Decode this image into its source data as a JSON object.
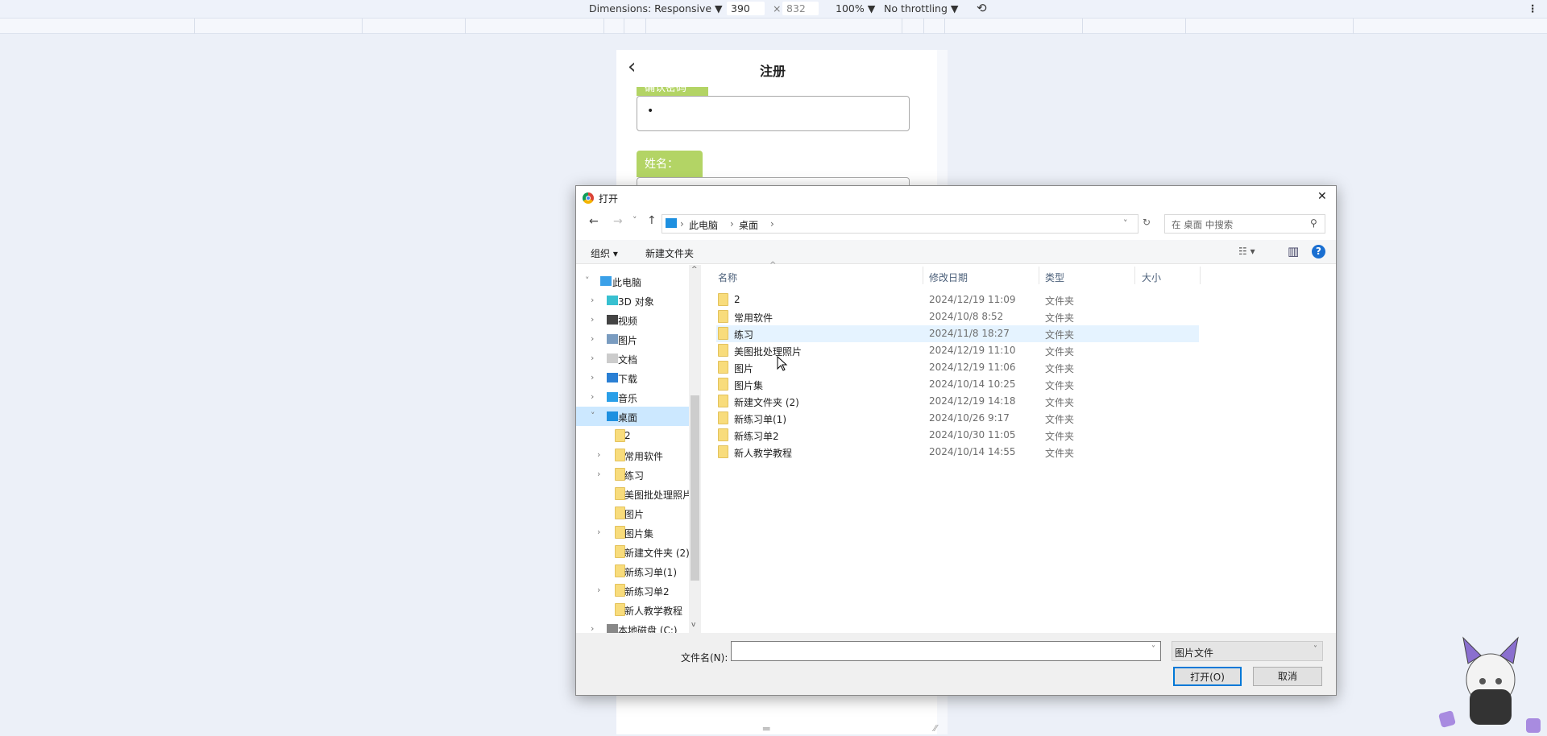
{
  "devtools": {
    "dimensions_label": "Dimensions: Responsive ▼",
    "width": "390",
    "times": "×",
    "height": "832",
    "zoom": "100% ▼",
    "throttling": "No throttling ▼",
    "rotate_icon": "rotate-icon",
    "more_icon": "⋮"
  },
  "mobile": {
    "back": "‹",
    "title": "注册",
    "field1_label": "确认密码",
    "field1_value": "•",
    "field2_label": "姓名：",
    "handle": "═",
    "resize": "⁄⁄"
  },
  "dialog": {
    "title": "打开",
    "close": "✕",
    "nav": {
      "back": "←",
      "forward": "→",
      "recent": "˅",
      "up": "↑",
      "breadcrumb": [
        "此电脑",
        "桌面"
      ],
      "sep": "›",
      "dropdown": "˅",
      "refresh": "↻",
      "search_placeholder": "在 桌面 中搜索",
      "search_icon": "⚲"
    },
    "toolbar": {
      "organize": "组织 ▾",
      "new_folder": "新建文件夹",
      "view": "☷ ▾",
      "pane": "▥",
      "help": "?"
    },
    "tree": [
      {
        "label": "此电脑",
        "chev": "˅",
        "icon": "pc"
      },
      {
        "label": "3D 对象",
        "chev": "›",
        "icon": "3d"
      },
      {
        "label": "视频",
        "chev": "›",
        "icon": "video"
      },
      {
        "label": "图片",
        "chev": "›",
        "icon": "picture"
      },
      {
        "label": "文档",
        "chev": "›",
        "icon": "doc"
      },
      {
        "label": "下载",
        "chev": "›",
        "icon": "download"
      },
      {
        "label": "音乐",
        "chev": "›",
        "icon": "music"
      },
      {
        "label": "桌面",
        "chev": "˅",
        "icon": "desktop"
      },
      {
        "label": "2",
        "chev": "",
        "icon": "folder"
      },
      {
        "label": "常用软件",
        "chev": "›",
        "icon": "folder"
      },
      {
        "label": "练习",
        "chev": "›",
        "icon": "folder"
      },
      {
        "label": "美图批处理照片",
        "chev": "",
        "icon": "folder"
      },
      {
        "label": "图片",
        "chev": "",
        "icon": "folder"
      },
      {
        "label": "图片集",
        "chev": "›",
        "icon": "folder"
      },
      {
        "label": "新建文件夹 (2)",
        "chev": "",
        "icon": "folder"
      },
      {
        "label": "新练习单(1)",
        "chev": "",
        "icon": "folder"
      },
      {
        "label": "新练习单2",
        "chev": "›",
        "icon": "folder"
      },
      {
        "label": "新人教学教程",
        "chev": "",
        "icon": "folder"
      },
      {
        "label": "本地磁盘 (C:)",
        "chev": "›",
        "icon": "drive"
      }
    ],
    "columns": [
      "名称",
      "修改日期",
      "类型",
      "大小"
    ],
    "sort_arrow": "^",
    "files": [
      {
        "name": "2",
        "date": "2024/12/19 11:09",
        "type": "文件夹"
      },
      {
        "name": "常用软件",
        "date": "2024/10/8 8:52",
        "type": "文件夹"
      },
      {
        "name": "练习",
        "date": "2024/11/8 18:27",
        "type": "文件夹"
      },
      {
        "name": "美图批处理照片",
        "date": "2024/12/19 11:10",
        "type": "文件夹"
      },
      {
        "name": "图片",
        "date": "2024/12/19 11:06",
        "type": "文件夹"
      },
      {
        "name": "图片集",
        "date": "2024/10/14 10:25",
        "type": "文件夹"
      },
      {
        "name": "新建文件夹 (2)",
        "date": "2024/12/19 14:18",
        "type": "文件夹"
      },
      {
        "name": "新练习单(1)",
        "date": "2024/10/26 9:17",
        "type": "文件夹"
      },
      {
        "name": "新练习单2",
        "date": "2024/10/30 11:05",
        "type": "文件夹"
      },
      {
        "name": "新人教学教程",
        "date": "2024/10/14 14:55",
        "type": "文件夹"
      }
    ],
    "filename_label": "文件名(N):",
    "filename_value": "",
    "filetype": "图片文件",
    "open": "打开(O)",
    "cancel": "取消"
  }
}
